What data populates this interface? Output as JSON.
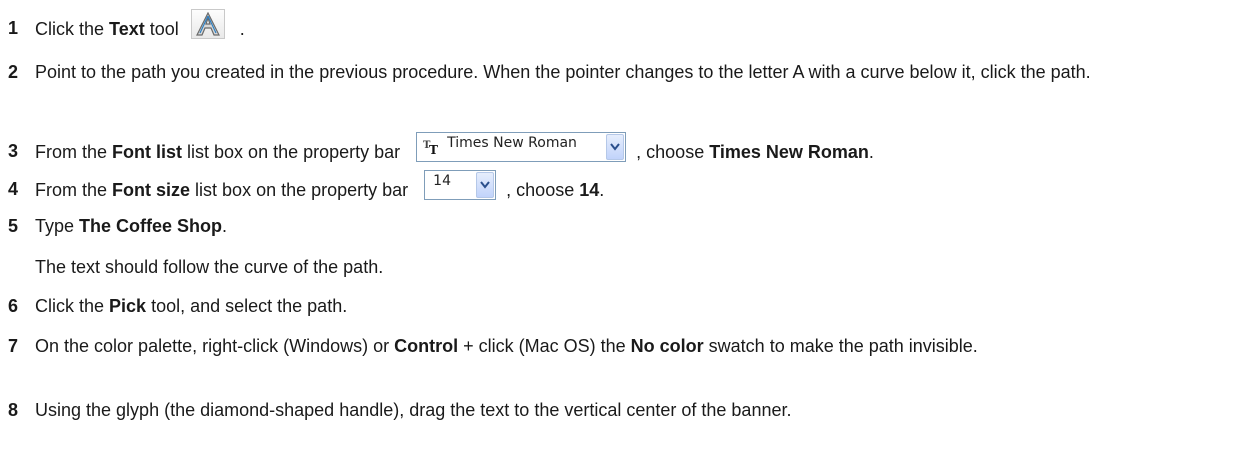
{
  "steps": [
    {
      "number": "1",
      "parts": {
        "a": "Click the ",
        "b": "Text",
        "c": " tool",
        "d": " ."
      },
      "icon": "text-tool-icon"
    },
    {
      "number": "2",
      "text": "Point to the path you created in the previous procedure. When the pointer changes to the letter A with a curve below it, click the path."
    },
    {
      "number": "3",
      "parts": {
        "a": "From the ",
        "b": "Font list",
        "c": " list box  on the property bar ",
        "d": ", choose ",
        "e": "Times New Roman",
        "f": "."
      },
      "dropdown": {
        "value": "Times New Roman",
        "icon": "truetype-font-icon"
      }
    },
    {
      "number": "4",
      "parts": {
        "a": "From the ",
        "b": "Font size",
        "c": " list box  on the property bar ",
        "d": ", choose ",
        "e": "14",
        "f": "."
      },
      "dropdown": {
        "value": "14"
      }
    },
    {
      "number": "5",
      "parts": {
        "a": "Type ",
        "b": "The Coffee Shop",
        "c": "."
      },
      "note": "The text should follow the curve of the path."
    },
    {
      "number": "6",
      "parts": {
        "a": "Click the ",
        "b": "Pick",
        "c": " tool, and select the path."
      }
    },
    {
      "number": "7",
      "parts": {
        "a": "On the color palette, right-click (Windows) or ",
        "b": "Control",
        "c": " + click (Mac OS) the ",
        "d": "No color",
        "e": " swatch to make the path invisible."
      }
    },
    {
      "number": "8",
      "text": "Using the glyph (the diamond-shaped handle), drag the text to the vertical center of the banner."
    }
  ],
  "colors": {
    "text": "#1a1a1a",
    "dropdown_border": "#7f9db9",
    "dropdown_button": "#c1d3fb"
  }
}
